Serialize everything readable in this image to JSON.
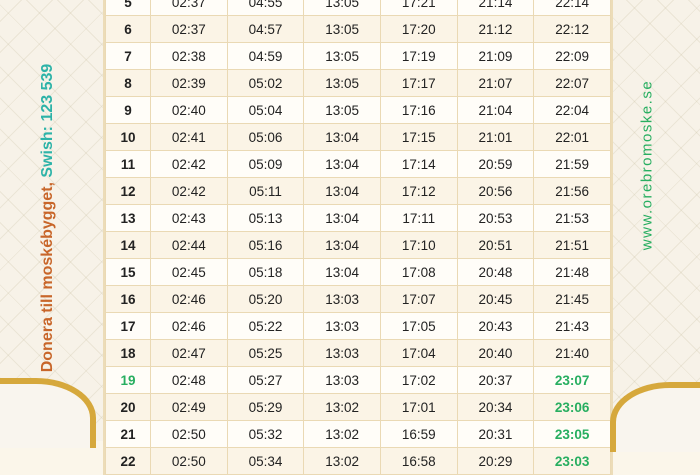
{
  "side_left": {
    "donate_text": "Donera till moskébygget, ",
    "swish_text": "Swish: 123 539"
  },
  "side_right": {
    "website": "www.orebromoske.se"
  },
  "accent_colors": {
    "highlight_green": "#27ae60",
    "donate_orange": "#c8662a",
    "swish_teal": "#2db3a8",
    "gold": "#d6a83c"
  },
  "rows": [
    {
      "day": "5",
      "c1": "02:37",
      "c2": "04:55",
      "c3": "13:05",
      "c4": "17:21",
      "c5": "21:14",
      "c6": "22:14",
      "hl_day": false,
      "hl_last": false
    },
    {
      "day": "6",
      "c1": "02:37",
      "c2": "04:57",
      "c3": "13:05",
      "c4": "17:20",
      "c5": "21:12",
      "c6": "22:12",
      "hl_day": false,
      "hl_last": false
    },
    {
      "day": "7",
      "c1": "02:38",
      "c2": "04:59",
      "c3": "13:05",
      "c4": "17:19",
      "c5": "21:09",
      "c6": "22:09",
      "hl_day": false,
      "hl_last": false
    },
    {
      "day": "8",
      "c1": "02:39",
      "c2": "05:02",
      "c3": "13:05",
      "c4": "17:17",
      "c5": "21:07",
      "c6": "22:07",
      "hl_day": false,
      "hl_last": false
    },
    {
      "day": "9",
      "c1": "02:40",
      "c2": "05:04",
      "c3": "13:05",
      "c4": "17:16",
      "c5": "21:04",
      "c6": "22:04",
      "hl_day": false,
      "hl_last": false
    },
    {
      "day": "10",
      "c1": "02:41",
      "c2": "05:06",
      "c3": "13:04",
      "c4": "17:15",
      "c5": "21:01",
      "c6": "22:01",
      "hl_day": false,
      "hl_last": false
    },
    {
      "day": "11",
      "c1": "02:42",
      "c2": "05:09",
      "c3": "13:04",
      "c4": "17:14",
      "c5": "20:59",
      "c6": "21:59",
      "hl_day": false,
      "hl_last": false
    },
    {
      "day": "12",
      "c1": "02:42",
      "c2": "05:11",
      "c3": "13:04",
      "c4": "17:12",
      "c5": "20:56",
      "c6": "21:56",
      "hl_day": false,
      "hl_last": false
    },
    {
      "day": "13",
      "c1": "02:43",
      "c2": "05:13",
      "c3": "13:04",
      "c4": "17:11",
      "c5": "20:53",
      "c6": "21:53",
      "hl_day": false,
      "hl_last": false
    },
    {
      "day": "14",
      "c1": "02:44",
      "c2": "05:16",
      "c3": "13:04",
      "c4": "17:10",
      "c5": "20:51",
      "c6": "21:51",
      "hl_day": false,
      "hl_last": false
    },
    {
      "day": "15",
      "c1": "02:45",
      "c2": "05:18",
      "c3": "13:04",
      "c4": "17:08",
      "c5": "20:48",
      "c6": "21:48",
      "hl_day": false,
      "hl_last": false
    },
    {
      "day": "16",
      "c1": "02:46",
      "c2": "05:20",
      "c3": "13:03",
      "c4": "17:07",
      "c5": "20:45",
      "c6": "21:45",
      "hl_day": false,
      "hl_last": false
    },
    {
      "day": "17",
      "c1": "02:46",
      "c2": "05:22",
      "c3": "13:03",
      "c4": "17:05",
      "c5": "20:43",
      "c6": "21:43",
      "hl_day": false,
      "hl_last": false
    },
    {
      "day": "18",
      "c1": "02:47",
      "c2": "05:25",
      "c3": "13:03",
      "c4": "17:04",
      "c5": "20:40",
      "c6": "21:40",
      "hl_day": false,
      "hl_last": false
    },
    {
      "day": "19",
      "c1": "02:48",
      "c2": "05:27",
      "c3": "13:03",
      "c4": "17:02",
      "c5": "20:37",
      "c6": "23:07",
      "hl_day": true,
      "hl_last": true
    },
    {
      "day": "20",
      "c1": "02:49",
      "c2": "05:29",
      "c3": "13:02",
      "c4": "17:01",
      "c5": "20:34",
      "c6": "23:06",
      "hl_day": false,
      "hl_last": true
    },
    {
      "day": "21",
      "c1": "02:50",
      "c2": "05:32",
      "c3": "13:02",
      "c4": "16:59",
      "c5": "20:31",
      "c6": "23:05",
      "hl_day": false,
      "hl_last": true
    },
    {
      "day": "22",
      "c1": "02:50",
      "c2": "05:34",
      "c3": "13:02",
      "c4": "16:58",
      "c5": "20:29",
      "c6": "23:03",
      "hl_day": false,
      "hl_last": true
    }
  ]
}
